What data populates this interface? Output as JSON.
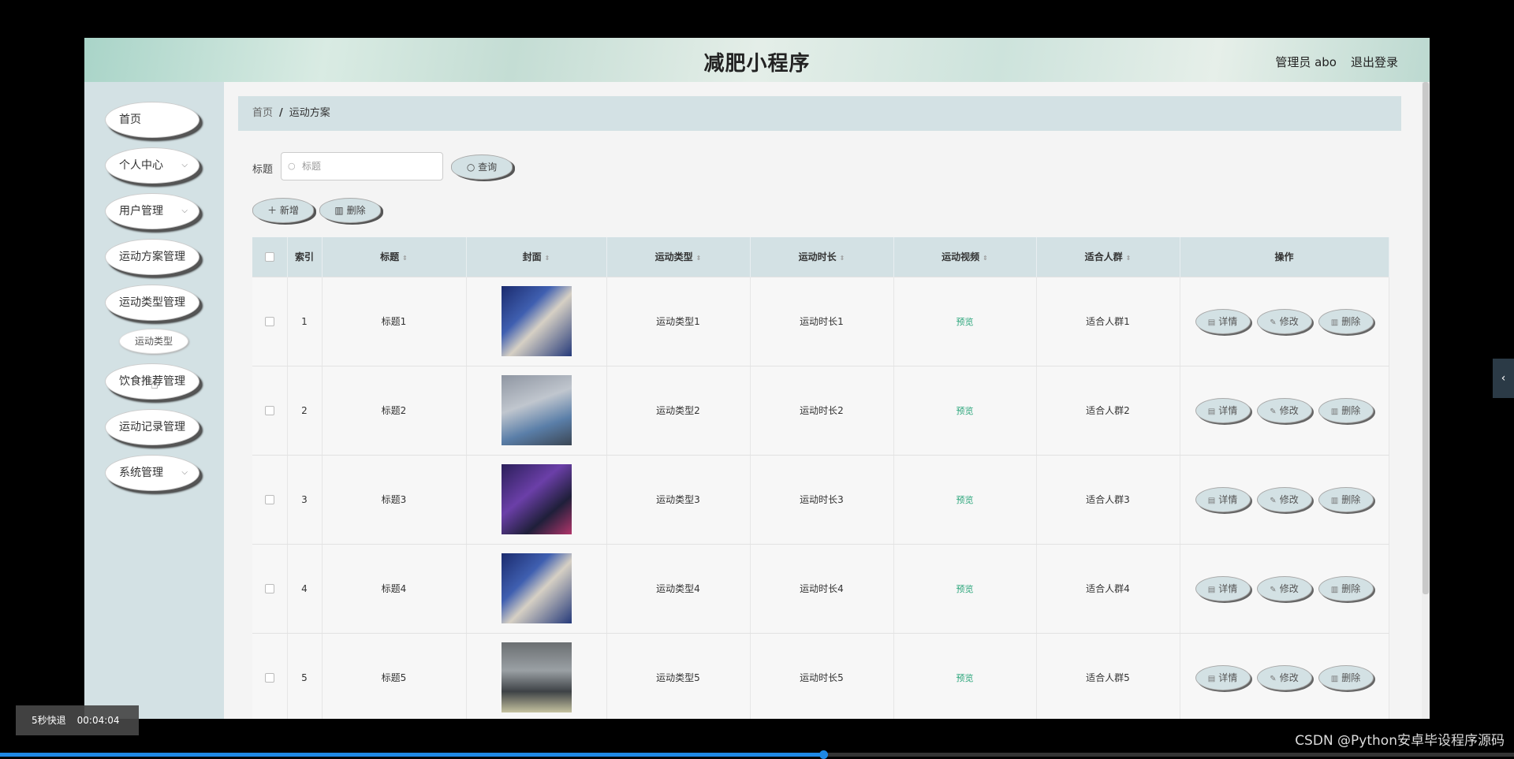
{
  "header": {
    "title": "减肥小程序",
    "user": "管理员 abo",
    "logout": "退出登录"
  },
  "sidebar": {
    "items": [
      {
        "label": "首页",
        "chev": ""
      },
      {
        "label": "个人中心",
        "chev": "⌵"
      },
      {
        "label": "用户管理",
        "chev": "⌵"
      },
      {
        "label": "运动方案管理",
        "chev": ""
      },
      {
        "label": "运动类型管理",
        "chev": ""
      },
      {
        "label": "饮食推荐管理",
        "chev": ""
      },
      {
        "label": "运动记录管理",
        "chev": ""
      },
      {
        "label": "系统管理",
        "chev": "⌵"
      }
    ],
    "sub_item": "运动类型"
  },
  "breadcrumb": {
    "home": "首页",
    "sep": "/",
    "current": "运动方案"
  },
  "search": {
    "label": "标题",
    "placeholder": "标题",
    "query_button": "查询"
  },
  "actions": {
    "add": "新增",
    "delete": "删除"
  },
  "table": {
    "columns": [
      "索引",
      "标题",
      "封面",
      "运动类型",
      "运动时长",
      "运动视频",
      "适合人群",
      "操作"
    ],
    "rows": [
      {
        "index": "1",
        "title": "标题1",
        "type": "运动类型1",
        "duration": "运动时长1",
        "video": "预览",
        "crowd": "适合人群1"
      },
      {
        "index": "2",
        "title": "标题2",
        "type": "运动类型2",
        "duration": "运动时长2",
        "video": "预览",
        "crowd": "适合人群2"
      },
      {
        "index": "3",
        "title": "标题3",
        "type": "运动类型3",
        "duration": "运动时长3",
        "video": "预览",
        "crowd": "适合人群3"
      },
      {
        "index": "4",
        "title": "标题4",
        "type": "运动类型4",
        "duration": "运动时长4",
        "video": "预览",
        "crowd": "适合人群4"
      },
      {
        "index": "5",
        "title": "标题5",
        "type": "运动类型5",
        "duration": "运动时长5",
        "video": "预览",
        "crowd": "适合人群5"
      }
    ],
    "row_actions": {
      "detail": "详情",
      "edit": "修改",
      "delete": "删除"
    }
  },
  "player": {
    "skip": "5秒快退",
    "time": "00:04:04",
    "progress": 0.544
  },
  "footer": {
    "credit": "CSDN @Python安卓毕设程序源码"
  },
  "colors": {
    "accent": "#d3e1e4",
    "preview": "#2aa57a",
    "progress": "#1e88e5"
  }
}
